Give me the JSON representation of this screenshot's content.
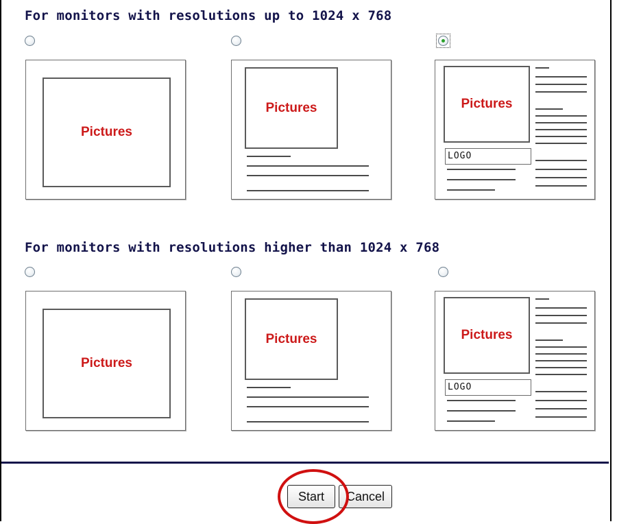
{
  "sections": [
    {
      "title": "For monitors with resolutions up to 1024 x 768",
      "selected_index": 2,
      "options": [
        {
          "picture_label": "Pictures"
        },
        {
          "picture_label": "Pictures"
        },
        {
          "picture_label": "Pictures",
          "logo_label": "LOGO"
        }
      ]
    },
    {
      "title": "For monitors with resolutions higher than 1024 x 768",
      "selected_index": -1,
      "options": [
        {
          "picture_label": "Pictures"
        },
        {
          "picture_label": "Pictures"
        },
        {
          "picture_label": "Pictures",
          "logo_label": "LOGO"
        }
      ]
    }
  ],
  "buttons": {
    "start_label": "Start",
    "cancel_label": "Cancel"
  },
  "colors": {
    "title": "#13134a",
    "picture_text": "#cc1a1a",
    "highlight": "#d01010",
    "selected_radio": "#2aa12a"
  }
}
